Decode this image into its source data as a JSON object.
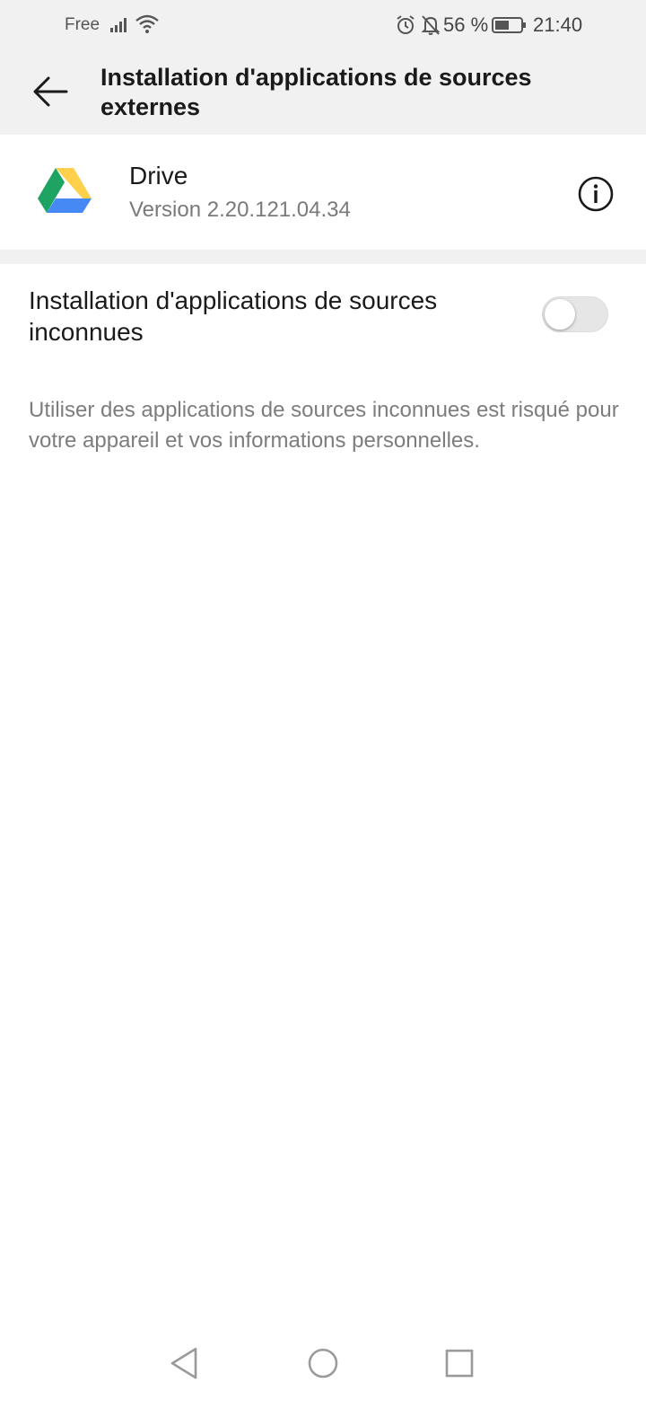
{
  "status_bar": {
    "carrier": "Free",
    "battery_percent": "56 %",
    "battery_level": 0.56,
    "time": "21:40",
    "icons": [
      "signal-icon",
      "wifi-icon",
      "alarm-icon",
      "notifications-off-icon",
      "battery-icon"
    ]
  },
  "header": {
    "title": "Installation d'applications de sources externes",
    "back_icon": "arrow-left-icon"
  },
  "app": {
    "name": "Drive",
    "version": "Version 2.20.121.04.34",
    "icon": "google-drive-icon",
    "info_icon": "info-icon"
  },
  "setting": {
    "label": "Installation d'applications de sources inconnues",
    "enabled": false,
    "description": "Utiliser des applications de sources inconnues est risqué pour votre appareil et vos informations personnelles."
  },
  "nav_bar": {
    "icons": [
      "nav-back-icon",
      "nav-home-icon",
      "nav-recent-icon"
    ]
  },
  "colors": {
    "header_bg": "#f1f1f1",
    "drive_green": "#1ea362",
    "drive_yellow": "#ffd04b",
    "drive_blue": "#4688f4"
  }
}
